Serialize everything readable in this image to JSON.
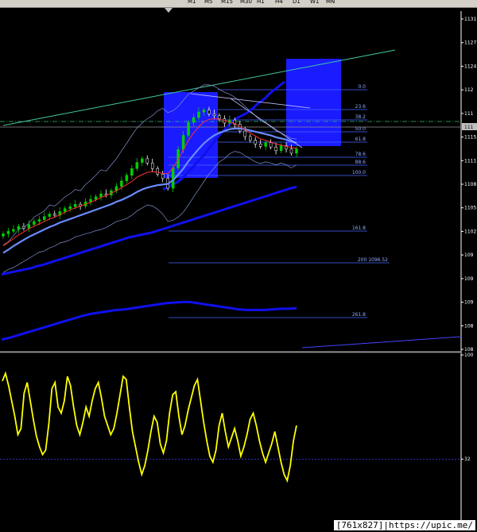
{
  "toolbar": {
    "timeframes": [
      "M1",
      "M5",
      "M15",
      "M30",
      "H1",
      "H4",
      "D1",
      "W1",
      "MN"
    ]
  },
  "colors": {
    "background": "#000000",
    "price_grid": "#3a3a3a",
    "up_candle": "#00d000",
    "down_candle": "#ffffff",
    "ma_fast": "#ff3030",
    "ma_mid": "#6a8cff",
    "ma_slow": "#1010ee",
    "envelope": "#8090d0",
    "fib": "#4466ff",
    "channel": "#40c8a0",
    "highlight": "#1b1bff",
    "oscillator": "#ffff00",
    "ref_line": "#4444ff"
  },
  "chart_data": [
    {
      "type": "line",
      "name": "price",
      "y_tick_labels": [
        "1131",
        "1127",
        "1124",
        "112",
        "111",
        "1115",
        "1111",
        "1108",
        "1105",
        "1102",
        "109",
        "109",
        "109",
        "108",
        "108"
      ],
      "fib_levels": [
        {
          "label": "0.0"
        },
        {
          "label": "23.6"
        },
        {
          "label": "38.2"
        },
        {
          "label": "50.0"
        },
        {
          "label": "61.8"
        },
        {
          "label": "78.6"
        },
        {
          "label": "88.6"
        },
        {
          "label": "100.0"
        },
        {
          "label": "161.8"
        },
        {
          "label": "200 1096.52"
        },
        {
          "label": "261.8"
        }
      ],
      "price_tag": "111",
      "ylim": [
        1082,
        1137
      ],
      "closes": [
        1100.8,
        1101.2,
        1101.5,
        1102.0,
        1101.7,
        1102.3,
        1102.8,
        1103.1,
        1103.6,
        1104.0,
        1103.8,
        1104.4,
        1104.9,
        1105.2,
        1105.6,
        1105.3,
        1106.0,
        1106.4,
        1106.8,
        1107.3,
        1107.1,
        1107.8,
        1108.5,
        1109.4,
        1110.3,
        1111.4,
        1112.4,
        1113.0,
        1112.3,
        1111.4,
        1110.5,
        1109.8,
        1108.2,
        1111.5,
        1114.5,
        1116.8,
        1118.9,
        1119.7,
        1120.6,
        1120.9,
        1120.3,
        1120.0,
        1119.5,
        1118.8,
        1119.3,
        1118.6,
        1117.5,
        1116.6,
        1116.0,
        1115.4,
        1115.0,
        1115.6,
        1114.9,
        1114.3,
        1115.1,
        1114.6,
        1113.9,
        1114.6
      ],
      "ma_fast": [
        1098.8,
        1099.4,
        1100.0,
        1100.6,
        1101.1,
        1101.6,
        1102.0,
        1102.4,
        1102.8,
        1103.2,
        1103.5,
        1103.9,
        1104.3,
        1104.7,
        1105.0,
        1105.3,
        1105.6,
        1105.9,
        1106.3,
        1106.7,
        1107.0,
        1107.4,
        1107.8,
        1108.3,
        1108.8,
        1109.3,
        1110.0,
        1110.4,
        1110.8,
        1110.9,
        1110.8,
        1110.6,
        1110.6,
        1111.5,
        1112.9,
        1114.5,
        1116.0,
        1117.2,
        1118.2,
        1119.0,
        1119.4,
        1119.5,
        1119.4,
        1119.2,
        1119.0,
        1118.7,
        1118.2,
        1117.7,
        1117.2,
        1116.7,
        1116.2,
        1116.0,
        1115.7,
        1115.4,
        1115.2,
        1115.0,
        1114.8,
        1114.7
      ],
      "ma_mid": [
        1097.7,
        1098.2,
        1098.8,
        1099.3,
        1099.8,
        1100.3,
        1100.7,
        1101.1,
        1101.5,
        1101.9,
        1102.2,
        1102.6,
        1102.9,
        1103.2,
        1103.5,
        1103.8,
        1104.1,
        1104.4,
        1104.7,
        1105.0,
        1105.3,
        1105.6,
        1106.0,
        1106.3,
        1106.7,
        1107.1,
        1107.6,
        1108.0,
        1108.3,
        1108.5,
        1108.7,
        1108.8,
        1108.9,
        1109.5,
        1110.4,
        1111.4,
        1112.6,
        1113.6,
        1114.6,
        1115.5,
        1116.2,
        1116.8,
        1117.2,
        1117.5,
        1117.8,
        1117.9,
        1117.9,
        1117.8,
        1117.6,
        1117.4,
        1117.2,
        1117.0,
        1116.8,
        1116.5,
        1116.3,
        1116.1,
        1115.8,
        1115.6
      ],
      "env_upper": [
        1099.0,
        1099.5,
        1100.5,
        1101.5,
        1101.8,
        1102.5,
        1103.5,
        1104.0,
        1104.5,
        1105.5,
        1105.3,
        1106.0,
        1106.8,
        1107.3,
        1108.0,
        1107.8,
        1108.8,
        1109.5,
        1110.3,
        1111.2,
        1111.0,
        1112.0,
        1113.0,
        1114.3,
        1115.5,
        1116.8,
        1118.0,
        1118.8,
        1119.5,
        1120.0,
        1120.8,
        1121.2,
        1120.5,
        1120.8,
        1121.5,
        1122.5,
        1123.5,
        1124.0,
        1124.5,
        1125.0,
        1125.0,
        1124.8,
        1124.3,
        1123.8,
        1123.5,
        1123.0,
        1122.3,
        1121.5,
        1120.8,
        1120.0,
        1119.2,
        1118.8,
        1118.2,
        1117.5,
        1117.2,
        1116.8,
        1116.3,
        1116.2
      ],
      "env_lower": [
        1094.5,
        1095.0,
        1095.3,
        1095.8,
        1096.3,
        1096.8,
        1097.3,
        1097.8,
        1098.0,
        1098.5,
        1098.8,
        1099.3,
        1099.5,
        1099.8,
        1100.3,
        1100.5,
        1100.8,
        1101.0,
        1101.3,
        1101.5,
        1101.8,
        1102.3,
        1102.8,
        1103.0,
        1103.3,
        1103.8,
        1104.5,
        1105.0,
        1105.5,
        1105.3,
        1104.8,
        1104.0,
        1102.8,
        1103.0,
        1103.5,
        1104.3,
        1105.5,
        1106.8,
        1108.0,
        1109.3,
        1110.5,
        1111.5,
        1112.5,
        1113.0,
        1113.8,
        1114.2,
        1114.0,
        1113.5,
        1113.0,
        1112.5,
        1112.2,
        1112.5,
        1112.3,
        1112.0,
        1112.3,
        1112.0,
        1111.5,
        1112.0
      ],
      "ma_slow_1": [
        1108.0,
        1108.2,
        1108.4,
        1108.6,
        1108.8,
        1109.0,
        1109.2,
        1109.5,
        1109.8,
        1110.2,
        1110.6,
        1111.0,
        1111.4,
        1111.8,
        1112.3,
        1112.7,
        1113.1,
        1113.5,
        1114.0,
        1114.5,
        1115.0,
        1115.5,
        1116.0,
        1116.5,
        1117.0,
        1117.4,
        1117.8,
        1118.2,
        1118.6,
        1119.0,
        1119.3,
        1119.6,
        1119.8,
        1120.0,
        1120.2,
        1120.4,
        1120.7,
        1121.0,
        1121.3,
        1121.7,
        1122.0,
        1122.3,
        1122.6,
        1122.9,
        1123.3,
        1123.7,
        1124.0,
        1124.3,
        1124.6,
        1124.9,
        1125.2,
        1125.5
      ],
      "ma_slow_2": [
        1094.2,
        1094.4,
        1094.6,
        1094.8,
        1095.0,
        1095.2,
        1095.5,
        1095.7,
        1096.0,
        1096.3,
        1096.6,
        1096.9,
        1097.2,
        1097.5,
        1097.8,
        1098.1,
        1098.4,
        1098.7,
        1099.0,
        1099.3,
        1099.6,
        1099.9,
        1100.2,
        1100.4,
        1100.6,
        1100.8,
        1101.0,
        1101.3,
        1101.6,
        1101.9,
        1102.2,
        1102.5,
        1102.8,
        1103.1,
        1103.4,
        1103.7,
        1104.0,
        1104.3,
        1104.6,
        1104.9,
        1105.2,
        1105.5,
        1105.8,
        1106.1,
        1106.4,
        1106.7,
        1107.0,
        1107.3,
        1107.6,
        1107.9,
        1108.2,
        1108.4
      ],
      "ma_slow_3": [
        1083.6,
        1083.9,
        1084.3,
        1084.7,
        1085.1,
        1085.5,
        1085.9,
        1086.3,
        1086.7,
        1087.1,
        1087.5,
        1087.8,
        1088.0,
        1088.2,
        1088.4,
        1088.5,
        1088.7,
        1088.9,
        1089.1,
        1089.3,
        1089.5,
        1089.6,
        1089.7,
        1089.7,
        1089.5,
        1089.3,
        1089.1,
        1088.9,
        1088.7,
        1088.5,
        1088.4,
        1088.4,
        1088.4,
        1088.5,
        1088.6,
        1088.6,
        1088.7
      ]
    },
    {
      "type": "line",
      "name": "oscillator",
      "y_tick_labels": [
        "100",
        "32"
      ],
      "ylim": [
        0,
        100
      ],
      "values": [
        83,
        88,
        80,
        70,
        60,
        48,
        52,
        75,
        82,
        70,
        58,
        47,
        40,
        35,
        38,
        55,
        78,
        82,
        66,
        62,
        70,
        86,
        80,
        66,
        54,
        48,
        56,
        66,
        60,
        70,
        78,
        82,
        72,
        60,
        54,
        48,
        52,
        62,
        74,
        86,
        84,
        66,
        50,
        40,
        30,
        22,
        28,
        38,
        50,
        60,
        56,
        42,
        36,
        44,
        62,
        74,
        76,
        60,
        48,
        54,
        64,
        72,
        80,
        84,
        70,
        56,
        44,
        34,
        30,
        38,
        54,
        62,
        50,
        40,
        46,
        52,
        44,
        34,
        40,
        48,
        58,
        62,
        54,
        44,
        36,
        30,
        36,
        42,
        50,
        40,
        30,
        22,
        18,
        28,
        44,
        54
      ]
    }
  ]
}
